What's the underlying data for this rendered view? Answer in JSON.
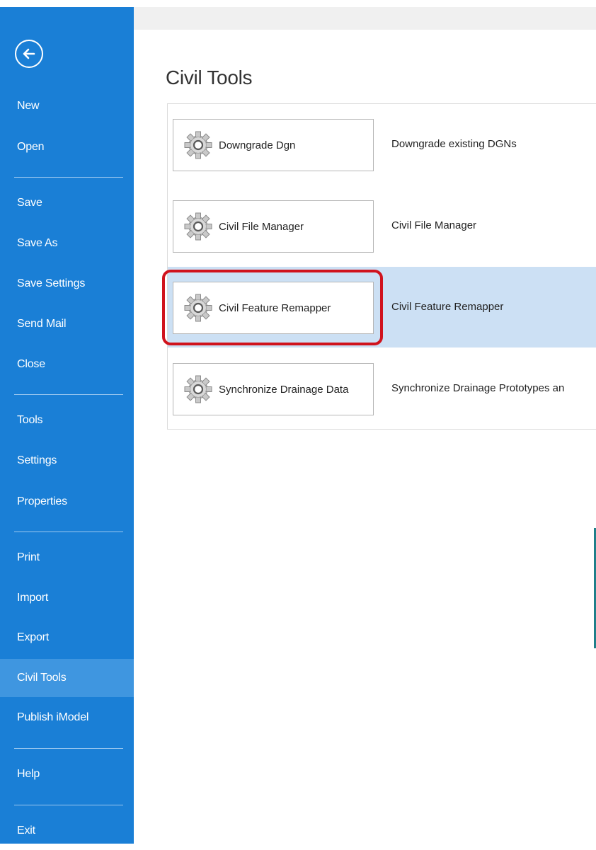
{
  "sidebar": {
    "back_icon": "back-arrow-circle-icon",
    "items": [
      {
        "label": "New"
      },
      {
        "label": "Open"
      },
      {
        "label": "Save"
      },
      {
        "label": "Save As"
      },
      {
        "label": "Save Settings"
      },
      {
        "label": "Send Mail"
      },
      {
        "label": "Close"
      },
      {
        "label": "Tools"
      },
      {
        "label": "Settings"
      },
      {
        "label": "Properties"
      },
      {
        "label": "Print"
      },
      {
        "label": "Import"
      },
      {
        "label": "Export"
      },
      {
        "label": "Civil Tools",
        "active": true
      },
      {
        "label": "Publish iModel"
      },
      {
        "label": "Help"
      },
      {
        "label": "Exit"
      }
    ]
  },
  "main": {
    "title": "Civil Tools",
    "tools": [
      {
        "label": "Downgrade Dgn",
        "description": "Downgrade existing DGNs",
        "icon": "gear-icon"
      },
      {
        "label": "Civil File Manager",
        "description": "Civil File Manager",
        "icon": "gear-icon"
      },
      {
        "label": "Civil Feature Remapper",
        "description": "Civil Feature Remapper",
        "icon": "gear-icon",
        "selected": true
      },
      {
        "label": "Synchronize Drainage Data",
        "description": "Synchronize Drainage Prototypes an",
        "icon": "gear-icon"
      }
    ]
  },
  "colors": {
    "sidebar_bg": "#1a7fd6",
    "sidebar_active": "#3f96e0",
    "row_selected": "#cce0f4",
    "highlight_ring": "#d0131d"
  }
}
